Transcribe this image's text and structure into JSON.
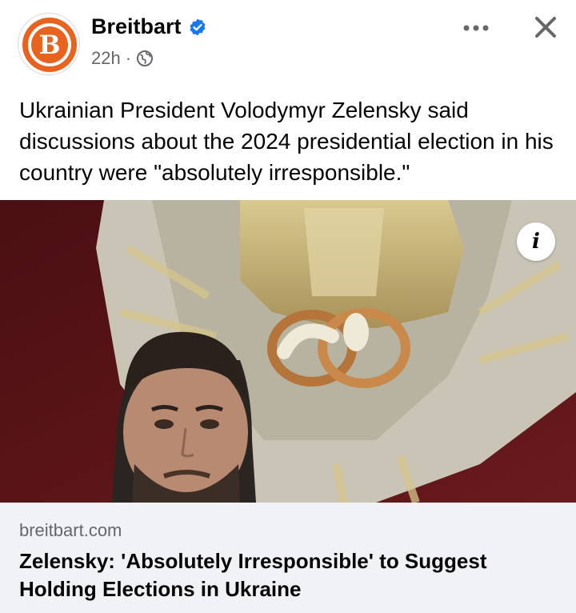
{
  "post": {
    "author": "Breitbart",
    "logo_letter": "B",
    "timestamp": "22h",
    "separator": "·",
    "privacy_icon": "globe-icon",
    "verified_icon": "verified-badge-icon",
    "text": "Ukrainian President Volodymyr Zelensky said discussions about the 2024 presidential election in his country were \"absolutely irresponsible.\""
  },
  "actions": {
    "more_icon": "more-horizontal-icon",
    "close_icon": "close-icon",
    "info_label": "i"
  },
  "link": {
    "domain": "breitbart.com",
    "title": "Zelensky: 'Absolutely Irresponsible' to Suggest Holding Elections in Ukraine"
  },
  "colors": {
    "brand_orange": "#e8641e",
    "verified_blue": "#1877f2",
    "secondary_text": "#65676b",
    "card_background": "#f0f2f5"
  }
}
